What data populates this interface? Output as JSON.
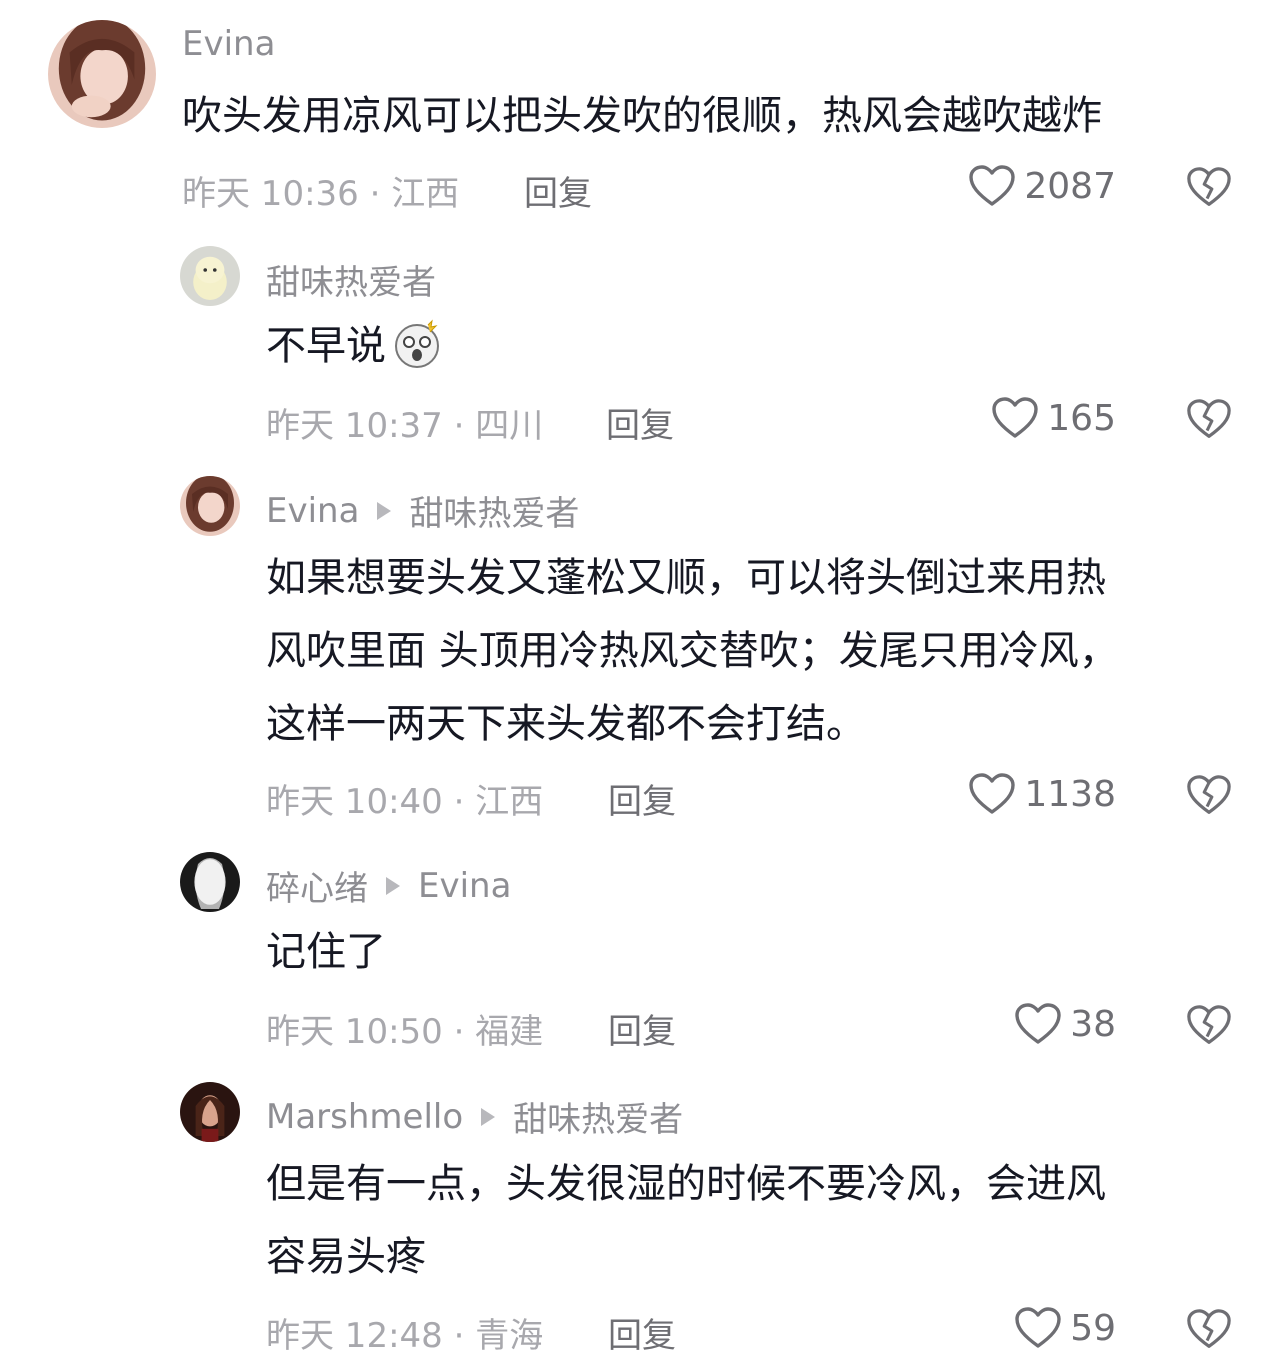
{
  "comments": [
    {
      "author": "Evina",
      "reply_to": "",
      "text": "吹头发用凉风可以把头发吹的很顺，热风会越吹越炸",
      "time_location": "昨天 10:36 · 江西",
      "reply_label": "回复",
      "likes": "2087"
    },
    {
      "author": "甜味热爱者",
      "reply_to": "",
      "text": "不早说",
      "time_location": "昨天 10:37 · 四川",
      "reply_label": "回复",
      "likes": "165"
    },
    {
      "author": "Evina",
      "reply_to": "甜味热爱者",
      "text_lines": [
        "如果想要头发又蓬松又顺，可以将头倒过来用热",
        "风吹里面 头顶用冷热风交替吹；发尾只用冷风，",
        "这样一两天下来头发都不会打结。"
      ],
      "time_location": "昨天 10:40 · 江西",
      "reply_label": "回复",
      "likes": "1138"
    },
    {
      "author": "碎心绪",
      "reply_to": "Evina",
      "text": "记住了",
      "time_location": "昨天 10:50 · 福建",
      "reply_label": "回复",
      "likes": "38"
    },
    {
      "author": "Marshmello",
      "reply_to": "甜味热爱者",
      "text_lines": [
        "但是有一点，头发很湿的时候不要冷风，会进风",
        "容易头疼"
      ],
      "time_location": "昨天 12:48 · 青海",
      "reply_label": "回复",
      "likes": "59"
    }
  ],
  "icons": {
    "like": "heart-outline-icon",
    "dislike": "broken-heart-icon",
    "reply_arrow": "play-triangle-icon",
    "emoji": "shocked-face-emoji"
  },
  "colors": {
    "text": "#161823",
    "name": "#8e8e93",
    "meta": "#a8a8ad",
    "action": "#6e6e73"
  }
}
